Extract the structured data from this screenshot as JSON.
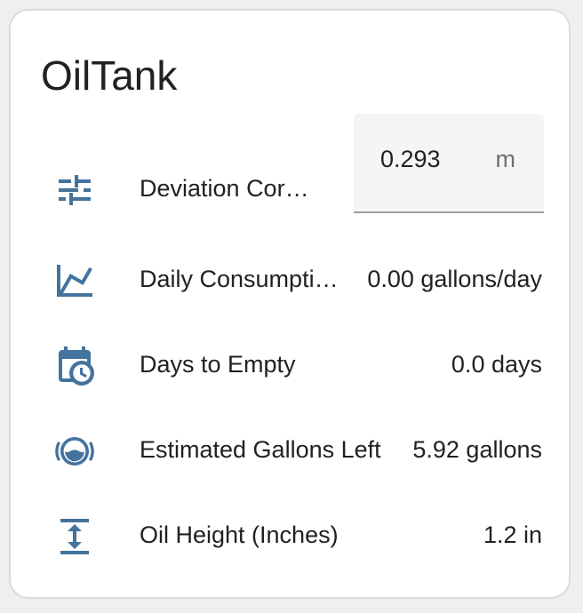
{
  "card": {
    "title": "OilTank",
    "icon_color": "#44739e"
  },
  "rows": [
    {
      "icon": "tune-variant-icon",
      "label": "Deviation Cor…",
      "input_value": "0.293",
      "unit": "m"
    },
    {
      "icon": "chart-line-icon",
      "label": "Daily Consumpti…",
      "value": "0.00 gallons/day"
    },
    {
      "icon": "calendar-clock-icon",
      "label": "Days to Empty",
      "value": "0.0 days"
    },
    {
      "icon": "gauge-tank-icon",
      "label": "Estimated Gallons Left",
      "value": "5.92 gallons"
    },
    {
      "icon": "arrow-expand-vertical-icon",
      "label": "Oil Height (Inches)",
      "value": "1.2 in"
    }
  ]
}
